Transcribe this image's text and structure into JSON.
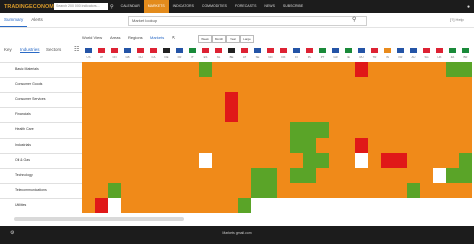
{
  "topbar": {
    "logo": "TRADINGECONOMICS",
    "search_placeholder": "Search 200 000 indicators...",
    "nav": [
      "CALENDAR",
      "MARKETS",
      "INDICATORS",
      "COMMODITIES",
      "FORECASTS",
      "NEWS",
      "SUBSCRIBE"
    ],
    "active_nav": "MARKETS"
  },
  "subbar": {
    "tabs": [
      "Summary",
      "Alerts"
    ],
    "active_tab": "Summary",
    "search_value": "Market lookup",
    "right_text": "[?] Help"
  },
  "viewbar": {
    "views": [
      "World View",
      "Areas",
      "Regions",
      "Markets"
    ],
    "active_view": "Markets",
    "last_buttons": [
      "Week",
      "Month",
      "Year",
      "Large"
    ]
  },
  "filters": {
    "tabs": [
      "Key",
      "Industries",
      "Sectors"
    ],
    "active_tab": "Industries"
  },
  "countries": [
    "US",
    "JP",
    "CN",
    "GB",
    "CH",
    "CA",
    "DE",
    "FR",
    "IT",
    "ES",
    "NL",
    "BE",
    "AT",
    "SE",
    "NO",
    "DK",
    "FI",
    "PL",
    "PT",
    "GR",
    "IE",
    "RU",
    "TR",
    "IN",
    "KR",
    "AU",
    "SG",
    "HK",
    "ZA",
    "BR"
  ],
  "flag_colors": [
    "#2454a6",
    "#d23",
    "#d23",
    "#2454a6",
    "#d23",
    "#d23",
    "#222",
    "#2454a6",
    "#1a8a3a",
    "#d23",
    "#d23",
    "#222",
    "#d23",
    "#2454a6",
    "#d23",
    "#d23",
    "#2454a6",
    "#d23",
    "#1a8a3a",
    "#2454a6",
    "#1a8a3a",
    "#2454a6",
    "#d23",
    "#e98b1c",
    "#2454a6",
    "#2454a6",
    "#d23",
    "#d23",
    "#1a8a3a",
    "#1a8a3a"
  ],
  "rows": [
    {
      "label": "Basic Materials",
      "cells": "OOOOOOOOOGOOOOOOOOOOORLOOOOOGG"
    },
    {
      "label": "Consumer Goods",
      "cells": "OOOOOOOOOOOOOOOOOOOOOOOOOOOOOO"
    },
    {
      "label": "Consumer Services",
      "cells": "OOOOOOOOOOOROOOOOOOOOOOOOOOOOO"
    },
    {
      "label": "Financials",
      "cells": "OOOOOOOOOOOROOOOOOOOOOOOOOOOOO"
    },
    {
      "label": "Health Care",
      "cells": "OOOOOOOOOOOOOOOOGGGOOOOOOOOOOO"
    },
    {
      "label": "Industrials",
      "cells": "OOOOOOOOOOOOOOOOGGOOOROOOOOOOO"
    },
    {
      "label": "Oil & Gas",
      "cells": "OOOOOOOOOWOOOOOOOGGOOWORROOOOG"
    },
    {
      "label": "Technology",
      "cells": "OOOOOOOOOOOOOGGOGGOOOOOOOOOWGG"
    },
    {
      "label": "Telecommunications",
      "cells": "OOGOOOOOOOOOOGGOOOOOOOOOOGOOOO"
    },
    {
      "label": "Utilities",
      "cells": "ORWOOOOOOOOOGWWWWWWWWWWWWWWWWW"
    }
  ],
  "colors": {
    "O": "#f08a19",
    "G": "#5aa428",
    "D": "#2f8a18",
    "R": "#e01818",
    "W": "#ffffff"
  },
  "status_text": "Markets gmail.com"
}
